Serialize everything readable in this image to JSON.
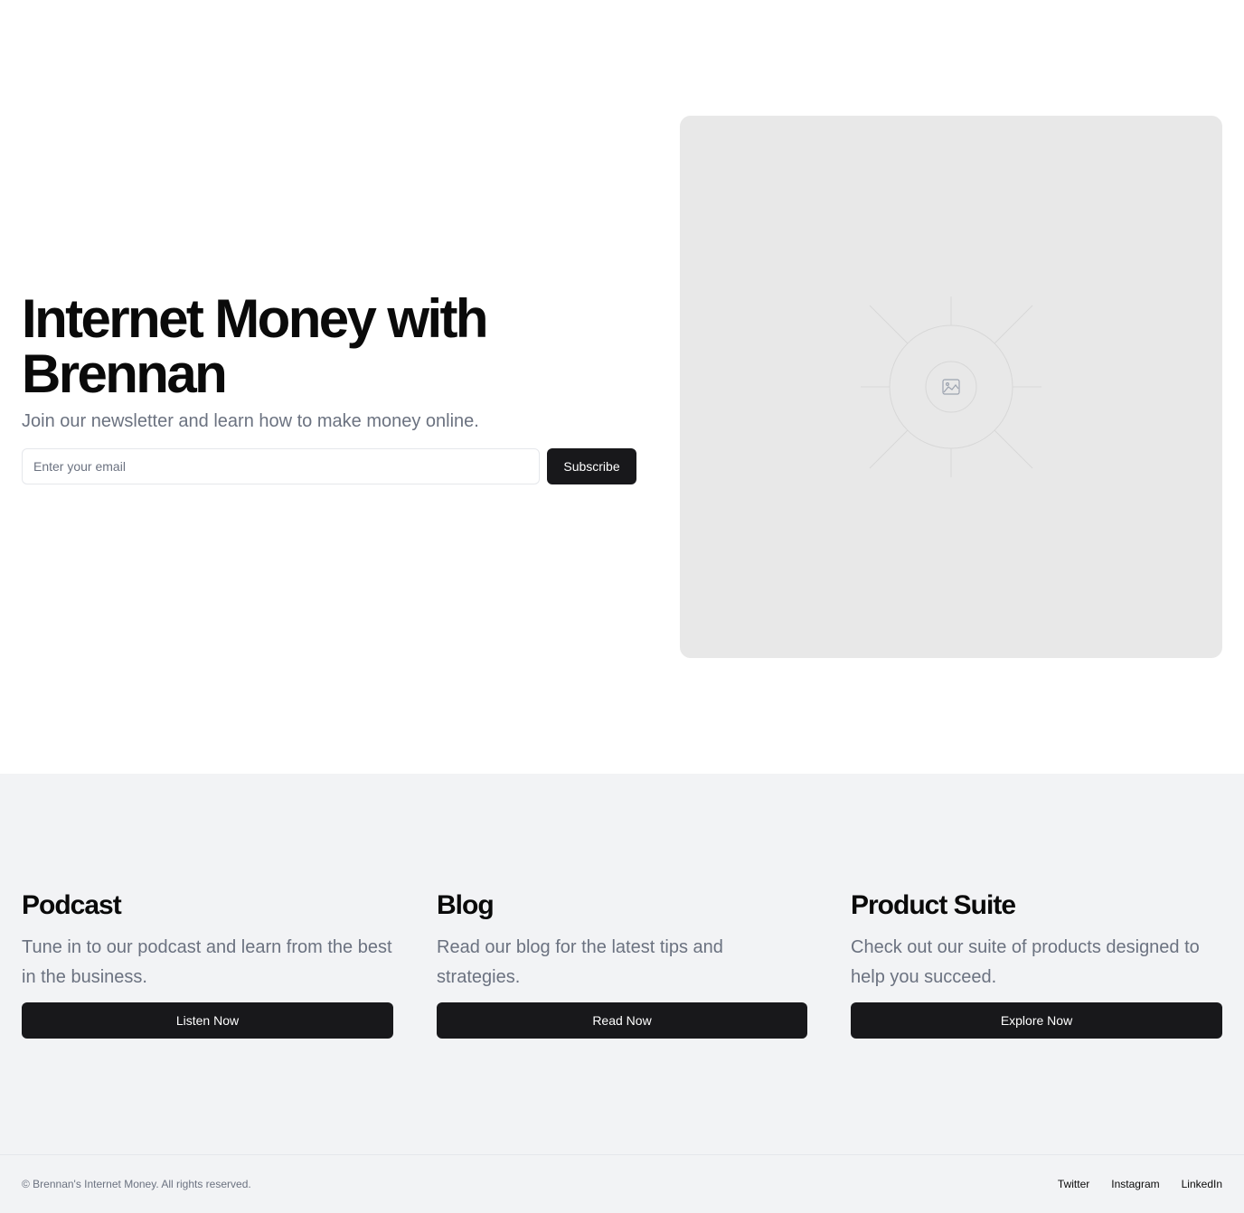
{
  "hero": {
    "title": "Internet Money with Brennan",
    "subtitle": "Join our newsletter and learn how to make money online.",
    "email_placeholder": "Enter your email",
    "subscribe_label": "Subscribe",
    "image_icon": "image-placeholder-icon"
  },
  "features": [
    {
      "title": "Podcast",
      "description": "Tune in to our podcast and learn from the best in the business.",
      "button_label": "Listen Now"
    },
    {
      "title": "Blog",
      "description": "Read our blog for the latest tips and strategies.",
      "button_label": "Read Now"
    },
    {
      "title": "Product Suite",
      "description": "Check out our suite of products designed to help you succeed.",
      "button_label": "Explore Now"
    }
  ],
  "footer": {
    "copyright": "© Brennan's Internet Money. All rights reserved.",
    "links": [
      "Twitter",
      "Instagram",
      "LinkedIn"
    ]
  },
  "colors": {
    "button_dark": "#18181b",
    "muted_text": "#6b7280",
    "section_bg": "#f2f3f5",
    "placeholder_bg": "#e8e8e8"
  }
}
